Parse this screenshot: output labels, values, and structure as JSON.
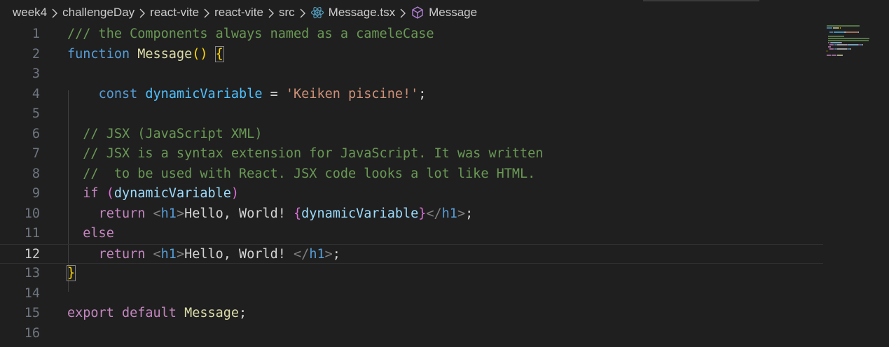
{
  "breadcrumb": {
    "items": [
      "week4",
      "challengeDay",
      "react-vite",
      "react-vite",
      "src"
    ],
    "file": "Message.tsx",
    "symbol": "Message"
  },
  "editor": {
    "current_line": 12,
    "lines": [
      {
        "n": "1",
        "tokens": [
          {
            "t": "comment",
            "v": "/// the Components always named as a cameleCase"
          }
        ]
      },
      {
        "n": "2",
        "tokens": [
          {
            "t": "keyword",
            "v": "function"
          },
          {
            "t": "text",
            "v": " "
          },
          {
            "t": "func",
            "v": "Message"
          },
          {
            "t": "brace1",
            "v": "()"
          },
          {
            "t": "text",
            "v": " "
          },
          {
            "t": "brace1",
            "v": "{",
            "box": true
          }
        ]
      },
      {
        "n": "3",
        "tokens": []
      },
      {
        "n": "4",
        "tokens": [
          {
            "t": "text",
            "v": "    "
          },
          {
            "t": "keyword",
            "v": "const"
          },
          {
            "t": "text",
            "v": " "
          },
          {
            "t": "var",
            "v": "dynamicVariable"
          },
          {
            "t": "text",
            "v": " = "
          },
          {
            "t": "string",
            "v": "'Keiken piscine!'"
          },
          {
            "t": "text",
            "v": ";"
          }
        ]
      },
      {
        "n": "5",
        "tokens": []
      },
      {
        "n": "6",
        "tokens": [
          {
            "t": "text",
            "v": "  "
          },
          {
            "t": "comment",
            "v": "// JSX (JavaScript XML)"
          }
        ]
      },
      {
        "n": "7",
        "tokens": [
          {
            "t": "text",
            "v": "  "
          },
          {
            "t": "comment",
            "v": "// JSX is a syntax extension for JavaScript. It was written"
          }
        ]
      },
      {
        "n": "8",
        "tokens": [
          {
            "t": "text",
            "v": "  "
          },
          {
            "t": "comment",
            "v": "//  to be used with React. JSX code looks a lot like HTML."
          }
        ]
      },
      {
        "n": "9",
        "tokens": [
          {
            "t": "text",
            "v": "  "
          },
          {
            "t": "control",
            "v": "if"
          },
          {
            "t": "text",
            "v": " "
          },
          {
            "t": "brace2",
            "v": "("
          },
          {
            "t": "param",
            "v": "dynamicVariable"
          },
          {
            "t": "brace2",
            "v": ")"
          }
        ]
      },
      {
        "n": "10",
        "tokens": [
          {
            "t": "text",
            "v": "    "
          },
          {
            "t": "control",
            "v": "return"
          },
          {
            "t": "text",
            "v": " "
          },
          {
            "t": "punct-tag",
            "v": "<"
          },
          {
            "t": "tag",
            "v": "h1"
          },
          {
            "t": "punct-tag",
            "v": ">"
          },
          {
            "t": "text",
            "v": "Hello, World! "
          },
          {
            "t": "brace2",
            "v": "{"
          },
          {
            "t": "param",
            "v": "dynamicVariable"
          },
          {
            "t": "brace2",
            "v": "}"
          },
          {
            "t": "punct-tag",
            "v": "</"
          },
          {
            "t": "tag",
            "v": "h1"
          },
          {
            "t": "punct-tag",
            "v": ">"
          },
          {
            "t": "text",
            "v": ";"
          }
        ]
      },
      {
        "n": "11",
        "tokens": [
          {
            "t": "text",
            "v": "  "
          },
          {
            "t": "control",
            "v": "else"
          }
        ]
      },
      {
        "n": "12",
        "tokens": [
          {
            "t": "text",
            "v": "    "
          },
          {
            "t": "control",
            "v": "return"
          },
          {
            "t": "text",
            "v": " "
          },
          {
            "t": "punct-tag",
            "v": "<"
          },
          {
            "t": "tag",
            "v": "h1"
          },
          {
            "t": "punct-tag",
            "v": ">"
          },
          {
            "t": "text",
            "v": "Hello, World! "
          },
          {
            "t": "punct-tag",
            "v": "</"
          },
          {
            "t": "tag",
            "v": "h1"
          },
          {
            "t": "punct-tag",
            "v": ">"
          },
          {
            "t": "text",
            "v": ";"
          }
        ]
      },
      {
        "n": "13",
        "tokens": [
          {
            "t": "brace1",
            "v": "}",
            "box": true
          }
        ]
      },
      {
        "n": "14",
        "tokens": []
      },
      {
        "n": "15",
        "tokens": [
          {
            "t": "control",
            "v": "export"
          },
          {
            "t": "text",
            "v": " "
          },
          {
            "t": "control",
            "v": "default"
          },
          {
            "t": "text",
            "v": " "
          },
          {
            "t": "func",
            "v": "Message"
          },
          {
            "t": "text",
            "v": ";"
          }
        ]
      },
      {
        "n": "16",
        "tokens": []
      }
    ]
  },
  "colors": {
    "background": "#1f1f1f",
    "comment": "#6a9955",
    "keyword": "#569cd6",
    "control": "#c586c0",
    "function": "#dcdcaa",
    "variable": "#4fc1ff",
    "string": "#ce9178",
    "react_icon": "#519aba",
    "symbol_icon": "#b180d7"
  },
  "icons": {
    "file_icon": "react-icon",
    "symbol_icon": "cube-icon",
    "separator_icon": "chevron-right-icon"
  }
}
